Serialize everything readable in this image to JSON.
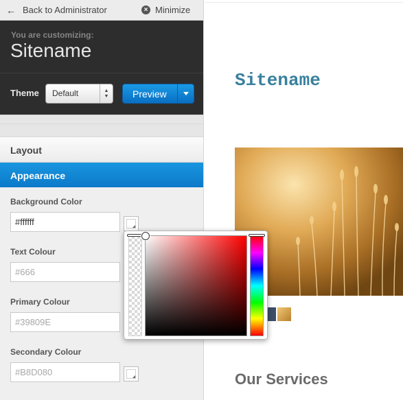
{
  "topbar": {
    "back_label": "Back to Administrator",
    "minimize_label": "Minimize"
  },
  "header": {
    "customizing_label": "You are customizing:",
    "site_name": "Sitename",
    "theme_label": "Theme",
    "theme_select_value": "Default",
    "preview_button_label": "Preview"
  },
  "sections": {
    "layout_label": "Layout",
    "appearance_label": "Appearance"
  },
  "fields": [
    {
      "label": "Background Color",
      "value": "#ffffff",
      "placeholder": "",
      "swatch_color": "#ffffff"
    },
    {
      "label": "Text Colour",
      "value": "",
      "placeholder": "#666",
      "swatch_color": "#666666"
    },
    {
      "label": "Primary Colour",
      "value": "",
      "placeholder": "#39809E",
      "swatch_color": "#39809E"
    },
    {
      "label": "Secondary Colour",
      "value": "",
      "placeholder": "#B8D080",
      "swatch_color": "#ffffff"
    }
  ],
  "preview": {
    "site_title": "Sitename",
    "services_heading": "Our Services",
    "title_color": "#39809e"
  },
  "icons": {
    "back": "arrow-left-icon",
    "minimize": "close-circle-icon",
    "theme_select": "select-arrows-icon",
    "preview_caret": "caret-down-icon"
  }
}
